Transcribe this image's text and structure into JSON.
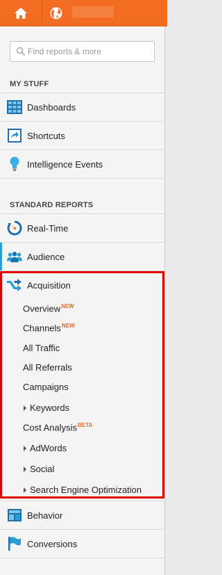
{
  "topbar": {
    "home_icon": "home-icon",
    "globe_icon": "globe-icon",
    "accent": "#f36c21"
  },
  "search": {
    "placeholder": "Find reports & more"
  },
  "my_stuff": {
    "header": "MY STUFF",
    "items": [
      {
        "label": "Dashboards",
        "icon": "dashboards-icon"
      },
      {
        "label": "Shortcuts",
        "icon": "shortcuts-icon"
      },
      {
        "label": "Intelligence Events",
        "icon": "lightbulb-icon"
      }
    ]
  },
  "standard_reports": {
    "header": "STANDARD REPORTS",
    "items": [
      {
        "label": "Real-Time",
        "icon": "realtime-icon"
      },
      {
        "label": "Audience",
        "icon": "audience-icon"
      },
      {
        "label": "Acquisition",
        "icon": "acquisition-icon"
      }
    ],
    "acquisition_sub": [
      {
        "label": "Overview",
        "badge": "NEW"
      },
      {
        "label": "Channels",
        "badge": "NEW"
      },
      {
        "label": "All Traffic"
      },
      {
        "label": "All Referrals"
      },
      {
        "label": "Campaigns"
      },
      {
        "label": "Keywords",
        "expandable": true
      },
      {
        "label": "Cost Analysis",
        "badge": "BETA"
      },
      {
        "label": "AdWords",
        "expandable": true
      },
      {
        "label": "Social",
        "expandable": true
      },
      {
        "label": "Search Engine Optimization",
        "expandable": true
      }
    ],
    "after": [
      {
        "label": "Behavior",
        "icon": "behavior-icon"
      },
      {
        "label": "Conversions",
        "icon": "conversions-flag-icon"
      }
    ]
  },
  "colors": {
    "highlight_box": "#e00000",
    "badge": "#e06a28",
    "active_bar": "#2a9fd6"
  }
}
